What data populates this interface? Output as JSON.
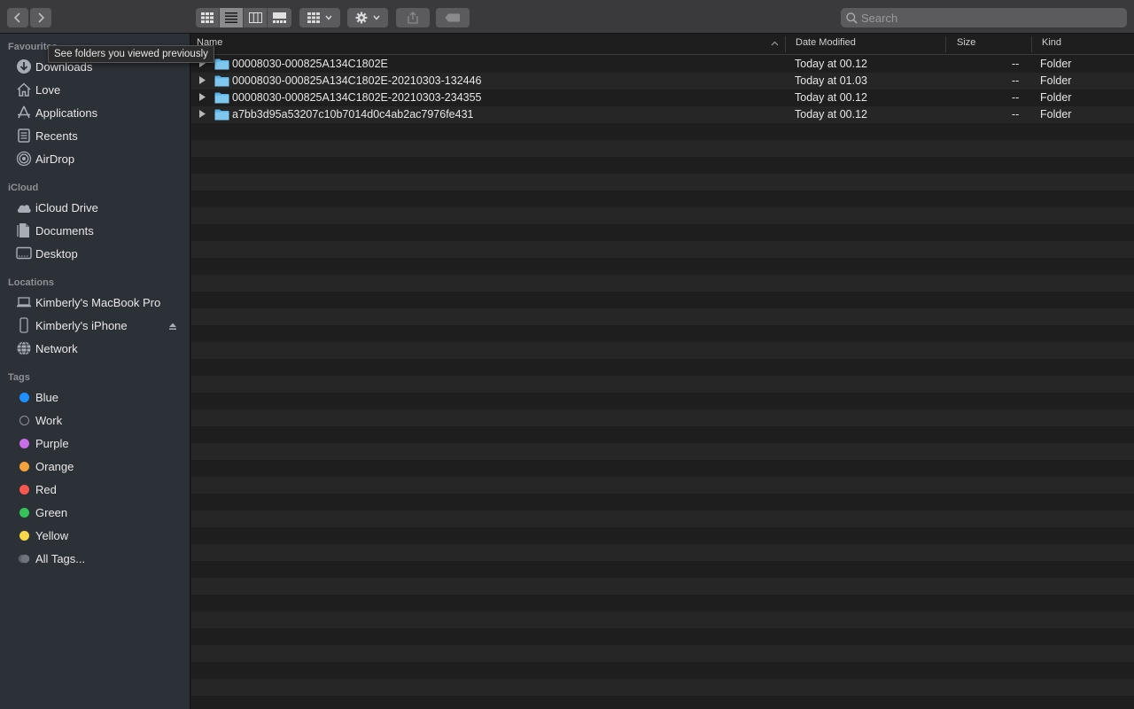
{
  "toolbar": {
    "back_icon": "chevron-left-icon",
    "forward_icon": "chevron-right-icon",
    "view_modes": [
      "icon-view",
      "list-view",
      "column-view",
      "gallery-view"
    ],
    "active_view": "list-view",
    "search_placeholder": "Search"
  },
  "tooltip": "See folders you viewed previously",
  "sidebar": {
    "favourites_title": "Favourites",
    "favourites": [
      {
        "label": "Downloads",
        "icon": "download-icon"
      },
      {
        "label": "Love",
        "icon": "home-icon"
      },
      {
        "label": "Applications",
        "icon": "applications-icon"
      },
      {
        "label": "Recents",
        "icon": "recents-icon"
      },
      {
        "label": "AirDrop",
        "icon": "airdrop-icon"
      }
    ],
    "icloud_title": "iCloud",
    "icloud": [
      {
        "label": "iCloud Drive",
        "icon": "cloud-icon"
      },
      {
        "label": "Documents",
        "icon": "document-icon"
      },
      {
        "label": "Desktop",
        "icon": "desktop-icon"
      }
    ],
    "locations_title": "Locations",
    "locations": [
      {
        "label": "Kimberly's MacBook Pro",
        "icon": "laptop-icon"
      },
      {
        "label": "Kimberly's iPhone",
        "icon": "iphone-icon"
      },
      {
        "label": "Network",
        "icon": "network-icon"
      }
    ],
    "tags_title": "Tags",
    "tags": [
      {
        "label": "Blue",
        "color": "#1e90ff"
      },
      {
        "label": "Work",
        "color": ""
      },
      {
        "label": "Purple",
        "color": "#c86ce8"
      },
      {
        "label": "Orange",
        "color": "#f5a13c"
      },
      {
        "label": "Red",
        "color": "#f5584f"
      },
      {
        "label": "Green",
        "color": "#36c25a"
      },
      {
        "label": "Yellow",
        "color": "#f6d748"
      },
      {
        "label": "All Tags...",
        "color": ""
      }
    ]
  },
  "columns": {
    "name": "Name",
    "date": "Date Modified",
    "size": "Size",
    "kind": "Kind"
  },
  "files": [
    {
      "name": "00008030-000825A134C1802E",
      "date": "Today at 00.12",
      "size": "--",
      "kind": "Folder"
    },
    {
      "name": "00008030-000825A134C1802E-20210303-132446",
      "date": "Today at 01.03",
      "size": "--",
      "kind": "Folder"
    },
    {
      "name": "00008030-000825A134C1802E-20210303-234355",
      "date": "Today at 00.12",
      "size": "--",
      "kind": "Folder"
    },
    {
      "name": "a7bb3d95a53207c10b7014d0c4ab2ac7976fe431",
      "date": "Today at 00.12",
      "size": "--",
      "kind": "Folder"
    }
  ],
  "colors": {
    "folder": "#5ab4e5",
    "accent": "#1e90ff"
  }
}
